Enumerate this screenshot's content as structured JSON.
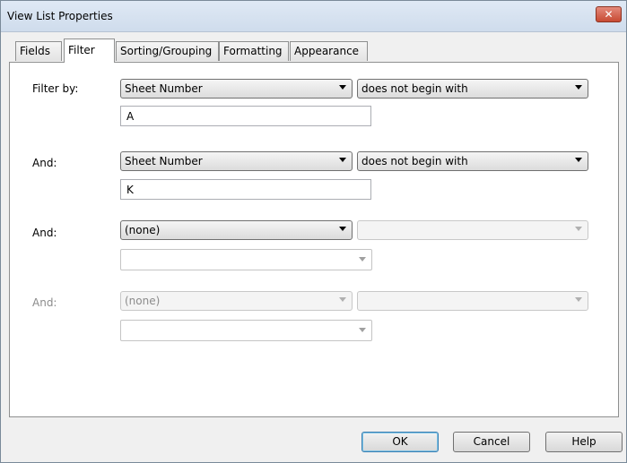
{
  "window": {
    "title": "View List Properties",
    "close_glyph": "✕"
  },
  "tabs": [
    {
      "label": "Fields"
    },
    {
      "label": "Filter"
    },
    {
      "label": "Sorting/Grouping"
    },
    {
      "label": "Formatting"
    },
    {
      "label": "Appearance"
    }
  ],
  "filters": [
    {
      "label": "Filter by:",
      "field": "Sheet Number",
      "operator": "does not begin with",
      "value": "A"
    },
    {
      "label": "And:",
      "field": "Sheet Number",
      "operator": "does not begin with",
      "value": "K"
    },
    {
      "label": "And:",
      "field": "(none)",
      "operator": "",
      "value": ""
    },
    {
      "label": "And:",
      "field": "(none)",
      "operator": "",
      "value": ""
    }
  ],
  "buttons": {
    "ok": "OK",
    "cancel": "Cancel",
    "help": "Help"
  }
}
